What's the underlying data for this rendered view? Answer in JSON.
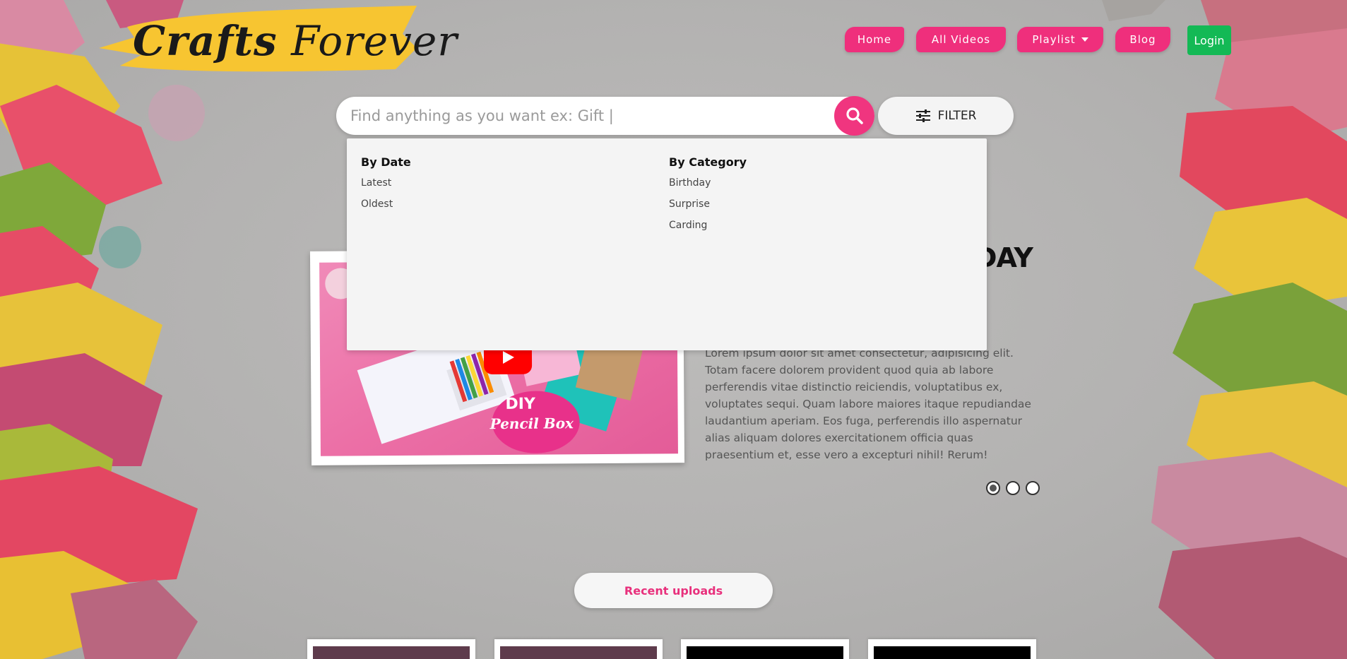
{
  "logo": {
    "word1": "Crafts",
    "word2": "Forever"
  },
  "nav": {
    "home": "Home",
    "all_videos": "All Videos",
    "playlist": "Playlist",
    "blog": "Blog",
    "login": "Login"
  },
  "search": {
    "placeholder": "Find anything as you want ex: Gift |",
    "filter_label": "FILTER"
  },
  "filter_dropdown": {
    "by_date": {
      "heading": "By Date",
      "items": [
        "Latest",
        "Oldest"
      ]
    },
    "by_category": {
      "heading": "By Category",
      "items": [
        "Birthday",
        "Surprise",
        "Carding"
      ]
    }
  },
  "hero": {
    "title_fragment": "DAY",
    "thumb_badge_line1": "DIY",
    "thumb_badge_line2": "Pencil Box",
    "description": "Lorem ipsum dolor sit amet consectetur, adipisicing elit. Totam facere dolorem provident quod quia ab labore perferendis vitae distinctio reiciendis, voluptatibus ex, voluptates sequi. Quam labore maiores itaque repudiandae laudantium aperiam. Eos fuga, perferendis illo aspernatur alias aliquam dolores exercitationem officia quas praesentium et, esse vero a excepturi nihil! Rerum!",
    "slides": 3,
    "active_slide": 1
  },
  "recent_uploads_label": "Recent uploads",
  "colors": {
    "brand_pink": "#ef2f7c",
    "login_green": "#13b955",
    "logo_yellow": "#f7c531"
  },
  "icons": [
    "search-icon",
    "filter-sliders-icon",
    "chevron-down-icon",
    "play-icon"
  ]
}
